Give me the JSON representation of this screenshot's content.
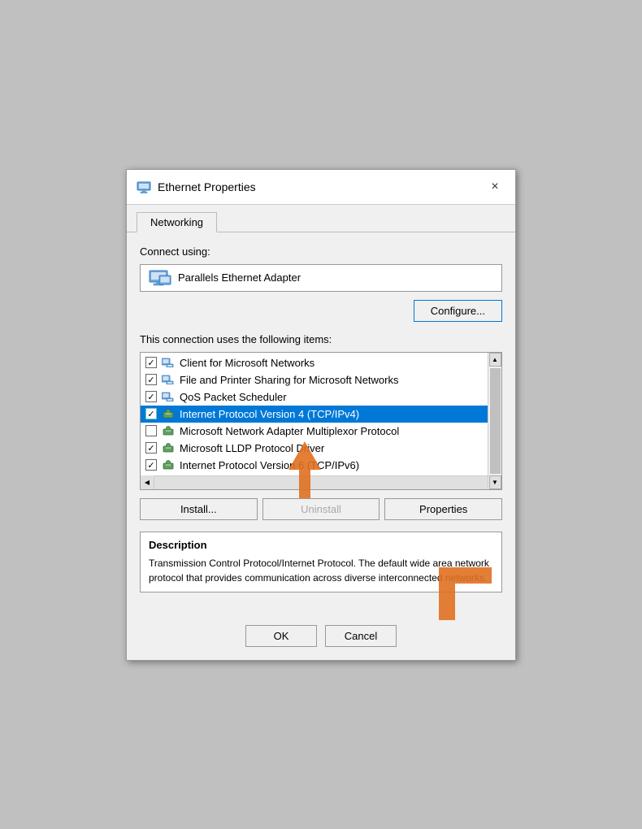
{
  "dialog": {
    "title": "Ethernet Properties",
    "close_label": "×",
    "tab": "Networking",
    "connect_using_label": "Connect using:",
    "adapter_name": "Parallels Ethernet Adapter",
    "configure_btn": "Configure...",
    "items_label": "This connection uses the following items:",
    "items": [
      {
        "checked": true,
        "icon": "network-icon",
        "label": "Client for Microsoft Networks",
        "selected": false
      },
      {
        "checked": true,
        "icon": "network-icon",
        "label": "File and Printer Sharing for Microsoft Networks",
        "selected": false
      },
      {
        "checked": true,
        "icon": "network-icon",
        "label": "QoS Packet Scheduler",
        "selected": false
      },
      {
        "checked": true,
        "icon": "green-network-icon",
        "label": "Internet Protocol Version 4 (TCP/IPv4)",
        "selected": true
      },
      {
        "checked": false,
        "icon": "green-network-icon",
        "label": "Microsoft Network Adapter Multiplexor Protocol",
        "selected": false
      },
      {
        "checked": true,
        "icon": "green-network-icon",
        "label": "Microsoft LLDP Protocol Driver",
        "selected": false
      },
      {
        "checked": true,
        "icon": "green-network-icon",
        "label": "Internet Protocol Version 6 (TCP/IPv6)",
        "selected": false
      }
    ],
    "install_btn": "Install...",
    "uninstall_btn": "Uninstall",
    "properties_btn": "Properties",
    "description_title": "Description",
    "description_text": "Transmission Control Protocol/Internet Protocol. The default wide area network protocol that provides communication across diverse interconnected networks.",
    "ok_btn": "OK",
    "cancel_btn": "Cancel"
  }
}
